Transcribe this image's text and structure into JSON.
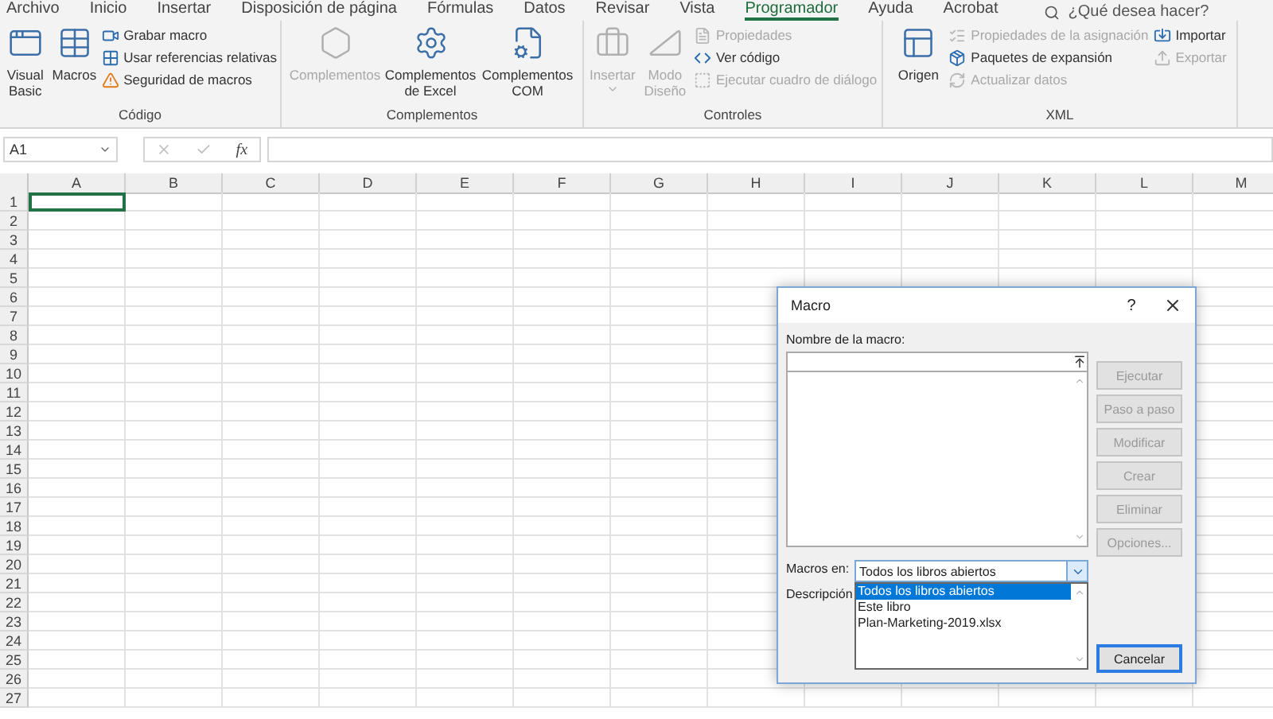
{
  "menu_tabs": [
    {
      "label": "Archivo",
      "selected": false
    },
    {
      "label": "Inicio",
      "selected": false
    },
    {
      "label": "Insertar",
      "selected": false
    },
    {
      "label": "Disposición de página",
      "selected": false
    },
    {
      "label": "Fórmulas",
      "selected": false
    },
    {
      "label": "Datos",
      "selected": false
    },
    {
      "label": "Revisar",
      "selected": false
    },
    {
      "label": "Vista",
      "selected": false
    },
    {
      "label": "Programador",
      "selected": true
    },
    {
      "label": "Ayuda",
      "selected": false
    },
    {
      "label": "Acrobat",
      "selected": false
    }
  ],
  "tell_me": {
    "placeholder": "¿Qué desea hacer?"
  },
  "ribbon_groups": [
    {
      "name": "Código",
      "items": [
        {
          "kind": "large",
          "label": "Visual Basic",
          "disabled": false
        },
        {
          "kind": "large",
          "label": "Macros",
          "disabled": false
        },
        {
          "kind": "stack",
          "children": [
            {
              "label": "Grabar macro",
              "disabled": false
            },
            {
              "label": "Usar referencias relativas",
              "disabled": false
            },
            {
              "label": "Seguridad de macros",
              "disabled": false
            }
          ]
        }
      ]
    },
    {
      "name": "Complementos",
      "items": [
        {
          "kind": "large",
          "label": "Complementos",
          "disabled": true
        },
        {
          "kind": "large",
          "label": "Complementos de Excel",
          "disabled": false
        },
        {
          "kind": "large",
          "label": "Complementos COM",
          "disabled": false
        }
      ]
    },
    {
      "name": "Controles",
      "items": [
        {
          "kind": "large",
          "label": "Insertar",
          "disabled": true,
          "dropdown": true
        },
        {
          "kind": "large",
          "label": "Modo Diseño",
          "disabled": true
        },
        {
          "kind": "stack",
          "children": [
            {
              "label": "Propiedades",
              "disabled": true
            },
            {
              "label": "Ver código",
              "disabled": false
            },
            {
              "label": "Ejecutar cuadro de diálogo",
              "disabled": true
            }
          ]
        }
      ]
    },
    {
      "name": "XML",
      "items": [
        {
          "kind": "large",
          "label": "Origen",
          "disabled": false
        },
        {
          "kind": "stack",
          "children": [
            {
              "label": "Propiedades de la asignación",
              "disabled": true
            },
            {
              "label": "Paquetes de expansión",
              "disabled": false
            },
            {
              "label": "Actualizar datos",
              "disabled": true
            }
          ]
        },
        {
          "kind": "stack",
          "children": [
            {
              "label": "Importar",
              "disabled": false
            },
            {
              "label": "Exportar",
              "disabled": true
            }
          ]
        }
      ]
    }
  ],
  "formula_bar": {
    "name_box": "A1",
    "function_label": "fx"
  },
  "sheet": {
    "columns": [
      "A",
      "B",
      "C",
      "D",
      "E",
      "F",
      "G",
      "H",
      "I",
      "J",
      "K",
      "L",
      "M"
    ],
    "rows": [
      "1",
      "2",
      "3",
      "4",
      "5",
      "6",
      "7",
      "8",
      "9",
      "10",
      "11",
      "12",
      "13",
      "14",
      "15",
      "16",
      "17",
      "18",
      "19",
      "20",
      "21",
      "22",
      "23",
      "24",
      "25",
      "26",
      "27"
    ]
  },
  "dialog": {
    "title": "Macro",
    "help": "?",
    "name_label": "Nombre de la macro:",
    "buttons": [
      {
        "label": "Ejecutar",
        "disabled": true
      },
      {
        "label": "Paso a paso",
        "disabled": true
      },
      {
        "label": "Modificar",
        "disabled": true
      },
      {
        "label": "Crear",
        "disabled": true
      },
      {
        "label": "Eliminar",
        "disabled": true
      },
      {
        "label": "Opciones...",
        "disabled": true
      }
    ],
    "macros_in_label": "Macros en:",
    "macros_in_value": "Todos los libros abiertos",
    "description_label": "Descripción",
    "options": [
      {
        "label": "Todos los libros abiertos",
        "selected": true
      },
      {
        "label": "Este libro",
        "selected": false
      },
      {
        "label": "Plan-Marketing-2019.xlsx",
        "selected": false
      }
    ],
    "cancel": {
      "label": "Cancelar",
      "default": true
    }
  }
}
